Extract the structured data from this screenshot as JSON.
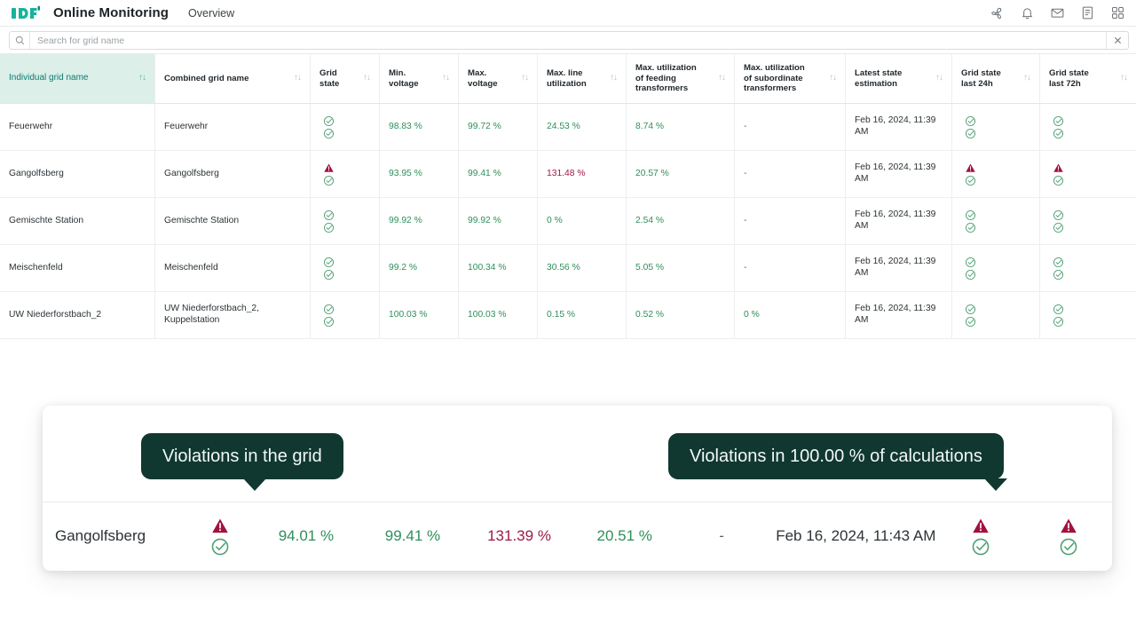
{
  "header": {
    "logo_icon": "icf-logo",
    "app_title": "Online Monitoring",
    "nav": "Overview",
    "icons": [
      {
        "name": "propeller-icon"
      },
      {
        "name": "bell-icon"
      },
      {
        "name": "envelope-icon"
      },
      {
        "name": "document-icon"
      },
      {
        "name": "apps-grid-icon"
      }
    ]
  },
  "search": {
    "placeholder": "Search for grid name",
    "value": "",
    "icon": "search-icon",
    "clear_icon": "close-icon"
  },
  "table": {
    "sort_glyph": "↑↓",
    "columns": [
      {
        "label": "Individual grid name",
        "key": "individual_grid_name"
      },
      {
        "label": "Combined grid name",
        "key": "combined_grid_name"
      },
      {
        "label": "Grid\nstate",
        "key": "grid_state"
      },
      {
        "label": "Min.\nvoltage",
        "key": "min_voltage"
      },
      {
        "label": "Max.\nvoltage",
        "key": "max_voltage"
      },
      {
        "label": "Max. line\nutilization",
        "key": "max_line_utilization"
      },
      {
        "label": "Max. utilization\nof feeding\ntransformers",
        "key": "max_util_feeding"
      },
      {
        "label": "Max. utilization\nof subordinate\ntransformers",
        "key": "max_util_subordinate"
      },
      {
        "label": "Latest state\nestimation",
        "key": "latest_state_estimation"
      },
      {
        "label": "Grid state\nlast 24h",
        "key": "grid_state_24h"
      },
      {
        "label": "Grid state\nlast 72h",
        "key": "grid_state_72h"
      }
    ],
    "rows": [
      {
        "individual_grid_name": "Feuerwehr",
        "combined_grid_name": "Feuerwehr",
        "grid_state": [
          "ok",
          "ok"
        ],
        "min_voltage": "98.83 %",
        "max_voltage": "99.72 %",
        "max_line_utilization": "24.53 %",
        "max_util_feeding": "8.74 %",
        "max_util_subordinate": "-",
        "latest_state_estimation": "Feb 16, 2024, 11:39 AM",
        "grid_state_24h": [
          "ok",
          "ok"
        ],
        "grid_state_72h": [
          "ok",
          "ok"
        ],
        "violations": []
      },
      {
        "individual_grid_name": "Gangolfsberg",
        "combined_grid_name": "Gangolfsberg",
        "grid_state": [
          "alert",
          "ok"
        ],
        "min_voltage": "93.95 %",
        "max_voltage": "99.41 %",
        "max_line_utilization": "131.48 %",
        "max_util_feeding": "20.57 %",
        "max_util_subordinate": "-",
        "latest_state_estimation": "Feb 16, 2024, 11:39 AM",
        "grid_state_24h": [
          "alert",
          "ok"
        ],
        "grid_state_72h": [
          "alert",
          "ok"
        ],
        "violations": [
          "max_line_utilization"
        ]
      },
      {
        "individual_grid_name": "Gemischte Station",
        "combined_grid_name": "Gemischte Station",
        "grid_state": [
          "ok",
          "ok"
        ],
        "min_voltage": "99.92 %",
        "max_voltage": "99.92 %",
        "max_line_utilization": "0 %",
        "max_util_feeding": "2.54 %",
        "max_util_subordinate": "-",
        "latest_state_estimation": "Feb 16, 2024, 11:39 AM",
        "grid_state_24h": [
          "ok",
          "ok"
        ],
        "grid_state_72h": [
          "ok",
          "ok"
        ],
        "violations": []
      },
      {
        "individual_grid_name": "Meischenfeld",
        "combined_grid_name": "Meischenfeld",
        "grid_state": [
          "ok",
          "ok"
        ],
        "min_voltage": "99.2 %",
        "max_voltage": "100.34 %",
        "max_line_utilization": "30.56 %",
        "max_util_feeding": "5.05 %",
        "max_util_subordinate": "-",
        "latest_state_estimation": "Feb 16, 2024, 11:39 AM",
        "grid_state_24h": [
          "ok",
          "ok"
        ],
        "grid_state_72h": [
          "ok",
          "ok"
        ],
        "violations": []
      },
      {
        "individual_grid_name": "UW Niederforstbach_2",
        "combined_grid_name": "UW Niederforstbach_2, Kuppelstation",
        "grid_state": [
          "ok",
          "ok"
        ],
        "min_voltage": "100.03 %",
        "max_voltage": "100.03 %",
        "max_line_utilization": "0.15 %",
        "max_util_feeding": "0.52 %",
        "max_util_subordinate": "0 %",
        "latest_state_estimation": "Feb 16, 2024, 11:39 AM",
        "grid_state_24h": [
          "ok",
          "ok"
        ],
        "grid_state_72h": [
          "ok",
          "ok"
        ],
        "violations": []
      }
    ]
  },
  "detail_card": {
    "tooltips": [
      {
        "name": "violations-in-grid-tooltip",
        "text": "Violations in the grid"
      },
      {
        "name": "violations-percent-tooltip",
        "text": "Violations in 100.00 % of calculations"
      }
    ],
    "row": {
      "individual_grid_name": "Gangolfsberg",
      "grid_state": [
        "alert",
        "ok"
      ],
      "min_voltage": "94.01 %",
      "max_voltage": "99.41 %",
      "max_line_utilization": "131.39 %",
      "max_util_feeding": "20.51 %",
      "max_util_subordinate": "-",
      "latest_state_estimation": "Feb 16, 2024, 11:43 AM",
      "grid_state_24h": [
        "alert",
        "ok"
      ],
      "grid_state_72h": [
        "alert",
        "ok"
      ]
    }
  },
  "colors": {
    "brand_teal": "#0f7a6c",
    "header_highlight_bg": "#dcefe9",
    "ok_green": "#2f8f5b",
    "alert_red": "#a2123f",
    "violation_text": "#9e1b45",
    "tooltip_bg": "#103830"
  }
}
